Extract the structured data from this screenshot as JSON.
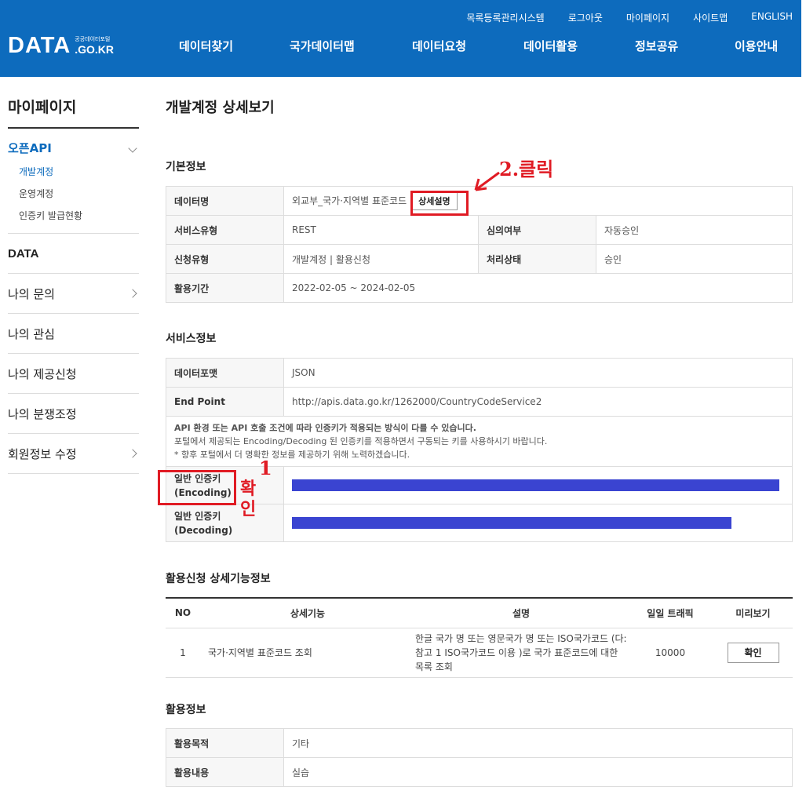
{
  "header": {
    "logo_main": "DATA",
    "logo_sub1": "공공데이터포털",
    "logo_sub2": ".GO.KR",
    "utility": [
      "목록등록관리시스템",
      "로그아웃",
      "마이페이지",
      "사이트맵",
      "ENGLISH"
    ],
    "gnb": [
      "데이터찾기",
      "국가데이터맵",
      "데이터요청",
      "데이터활용",
      "정보공유",
      "이용안내"
    ]
  },
  "sidebar": {
    "title": "마이페이지",
    "open_group": "오픈API",
    "sub_items": [
      "개발계정",
      "운영계정",
      "인증키 발급현황"
    ],
    "items": [
      "DATA",
      "나의 문의",
      "나의 관심",
      "나의 제공신청",
      "나의 분쟁조정",
      "회원정보 수정"
    ]
  },
  "page_title": "개발계정 상세보기",
  "basic": {
    "title": "기본정보",
    "data_name_label": "데이터명",
    "data_name_value": "외교부_국가·지역별 표준코드",
    "detail_button": "상세설명",
    "service_type_label": "서비스유형",
    "service_type_value": "REST",
    "review_label": "심의여부",
    "review_value": "자동승인",
    "apply_type_label": "신청유형",
    "apply_type_value": "개발계정 | 활용신청",
    "status_label": "처리상태",
    "status_value": "승인",
    "period_label": "활용기간",
    "period_value": "2022-02-05 ~ 2024-02-05"
  },
  "service": {
    "title": "서비스정보",
    "format_label": "데이터포맷",
    "format_value": "JSON",
    "endpoint_label": "End Point",
    "endpoint_value": "http://apis.data.go.kr/1262000/CountryCodeService2",
    "notice1": "API 환경 또는 API 호출 조건에 따라 인증키가 적용되는 방식이 다를 수 있습니다.",
    "notice2": "포털에서 제공되는 Encoding/Decoding 된 인증키를 적용하면서 구동되는 키를 사용하시기 바랍니다.",
    "notice3": "* 향후 포털에서 더 명확한 정보를 제공하기 위해 노력하겠습니다.",
    "enc_label_1": "일반 인증키",
    "enc_label_2": "(Encoding)",
    "dec_label_1": "일반 인증키",
    "dec_label_2": "(Decoding)"
  },
  "features": {
    "title": "활용신청 상세기능정보",
    "headers": [
      "NO",
      "상세기능",
      "설명",
      "일일 트래픽",
      "미리보기"
    ],
    "row": {
      "no": "1",
      "name": "국가·지역별 표준코드 조회",
      "desc": "한글 국가 명 또는 영문국가 명 또는 ISO국가코드 (다:참고 1 ISO국가코드 이용 )로 국가 표준코드에 대한 목록 조회",
      "traffic": "10000",
      "button": "확인"
    }
  },
  "usage": {
    "title": "활용정보",
    "purpose_label": "활용목적",
    "purpose_value": "기타",
    "content_label": "활용내용",
    "content_value": "실습"
  },
  "annotations": {
    "click_note": "2.클릭",
    "check_note_1": "1",
    "check_note_2": "확인"
  },
  "colors": {
    "header_bg": "#0d6bbd",
    "highlight": "#e01b24",
    "redaction": "#3a44d1"
  }
}
